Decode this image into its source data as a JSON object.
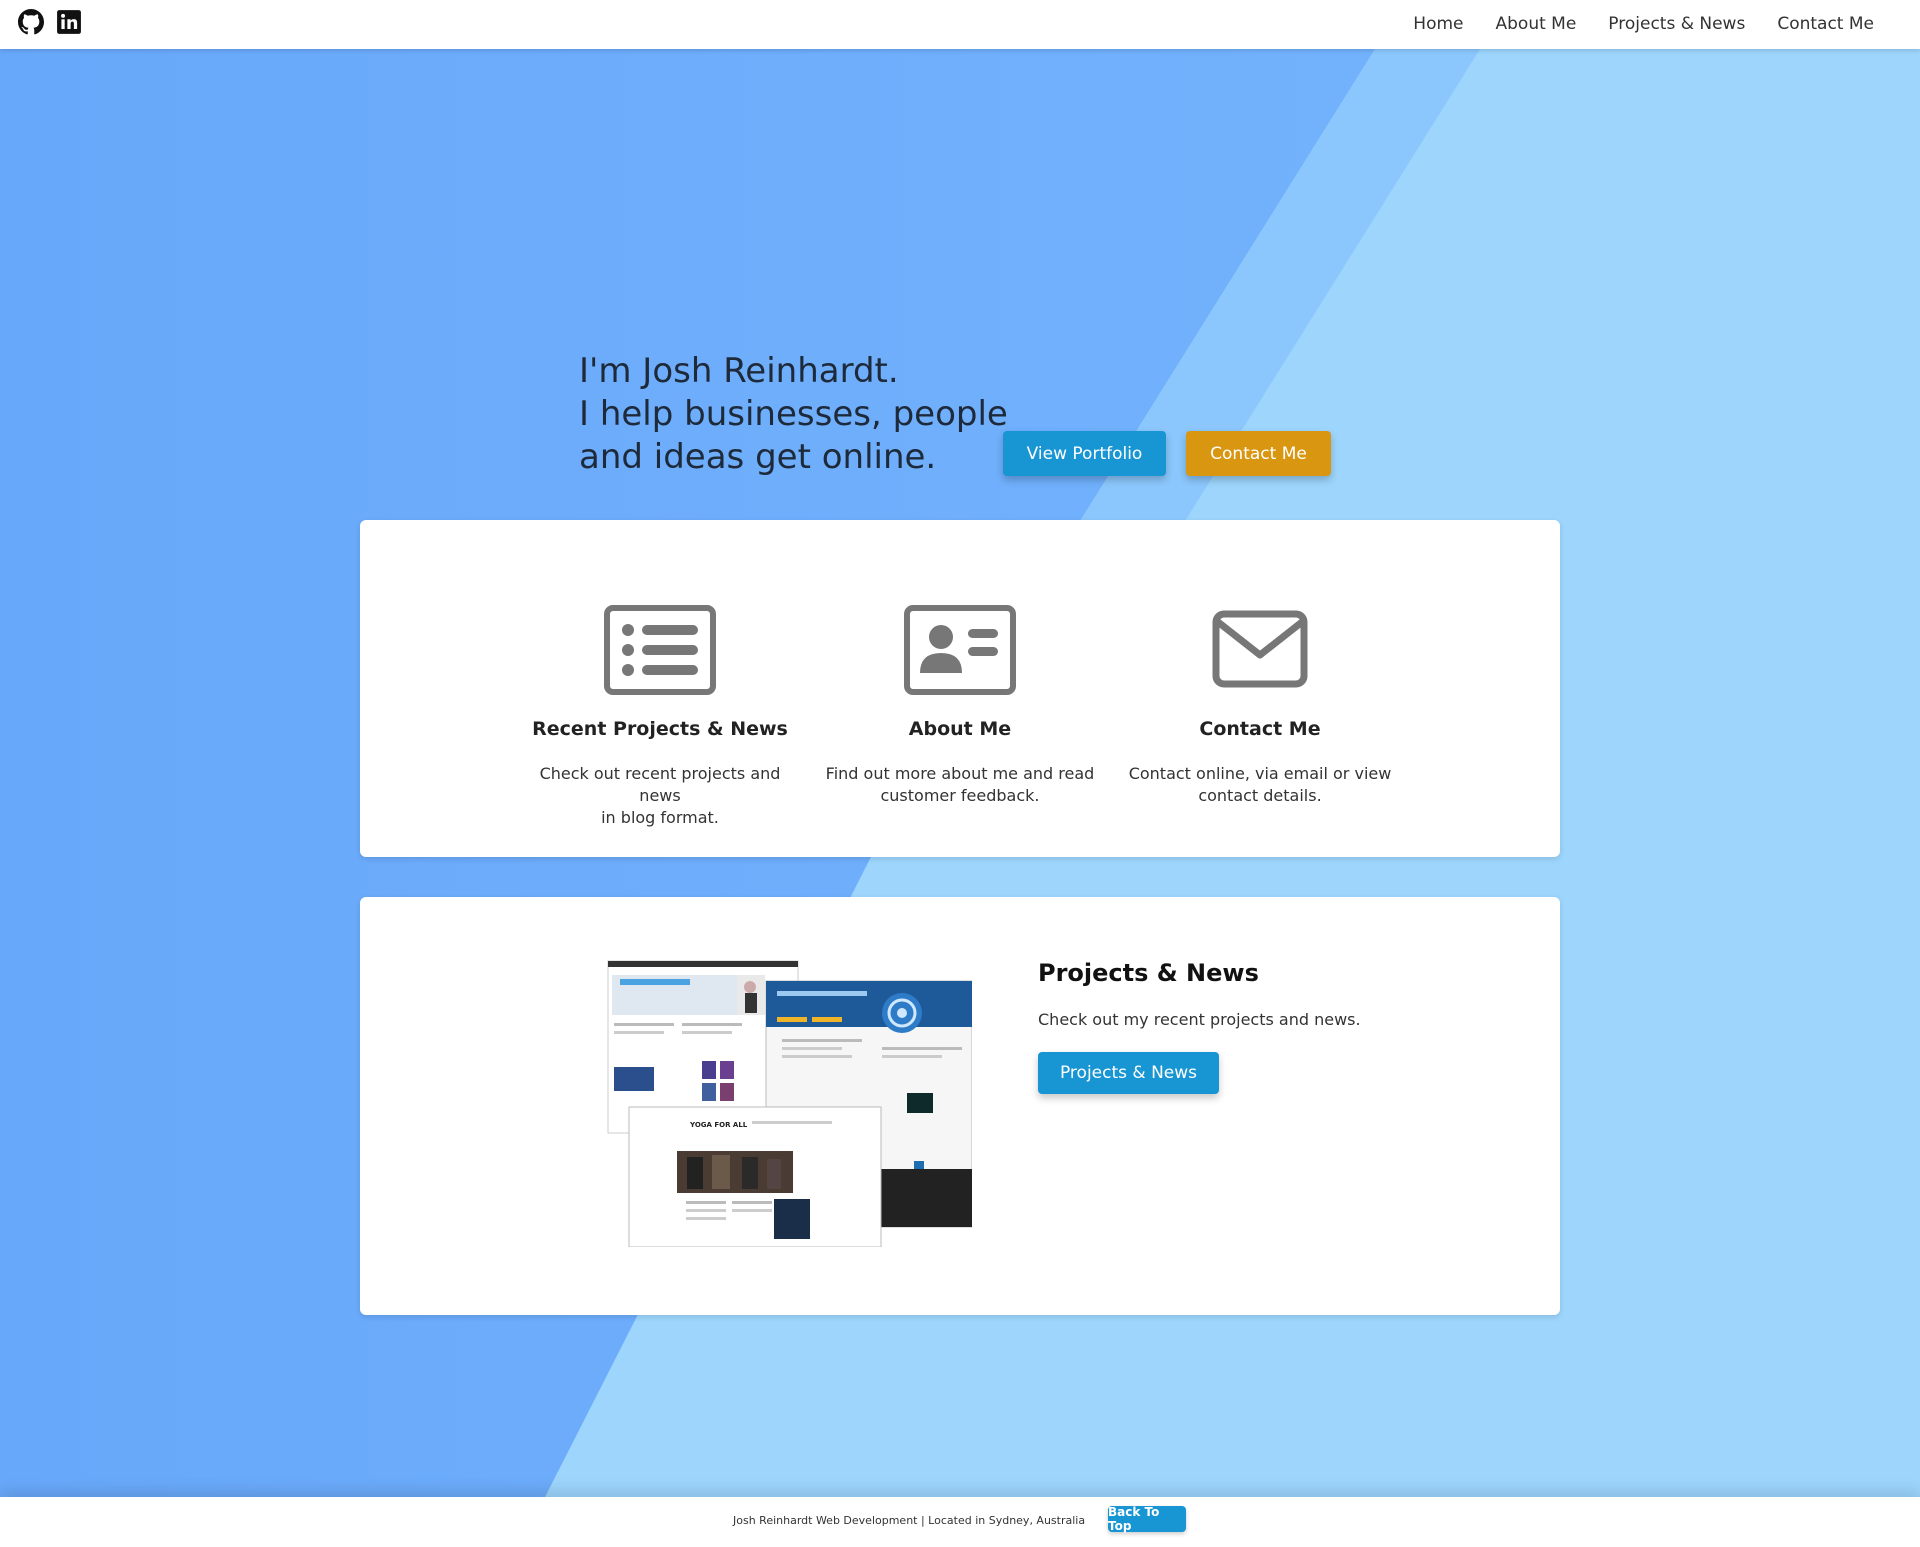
{
  "nav": {
    "social": [
      {
        "icon": "github-icon"
      },
      {
        "icon": "linkedin-icon"
      }
    ],
    "links": [
      {
        "label": "Home"
      },
      {
        "label": "About Me"
      },
      {
        "label": "Projects & News"
      },
      {
        "label": "Contact Me"
      }
    ]
  },
  "hero": {
    "lines": [
      "I'm Josh Reinhardt.",
      "I help businesses, people",
      "and ideas get online."
    ],
    "view_portfolio_label": "View Portfolio",
    "contact_label": "Contact Me"
  },
  "features": [
    {
      "icon": "list-icon",
      "title": "Recent Projects & News",
      "desc_line1": "Check out recent projects and news",
      "desc_line2": "in blog format."
    },
    {
      "icon": "id-card-icon",
      "title": "About Me",
      "desc_line1": "Find out more about me and read",
      "desc_line2": "customer feedback."
    },
    {
      "icon": "envelope-icon",
      "title": "Contact Me",
      "desc_line1": "Contact online, via email or view",
      "desc_line2": "contact details."
    }
  ],
  "projects": {
    "title": "Projects & News",
    "desc": "Check out my recent projects and news.",
    "button_label": "Projects & News",
    "mockup_text": "YOGA FOR ALL"
  },
  "footer": {
    "text": "Josh Reinhardt Web Development | Located in Sydney, Australia",
    "back_to_top_label": "Back To Top"
  },
  "colors": {
    "bg_light": "#9dd5fc",
    "bg_dark": "#6aaafa",
    "primary": "#1895d3",
    "accent": "#d99611",
    "icon_gray": "#777777"
  }
}
